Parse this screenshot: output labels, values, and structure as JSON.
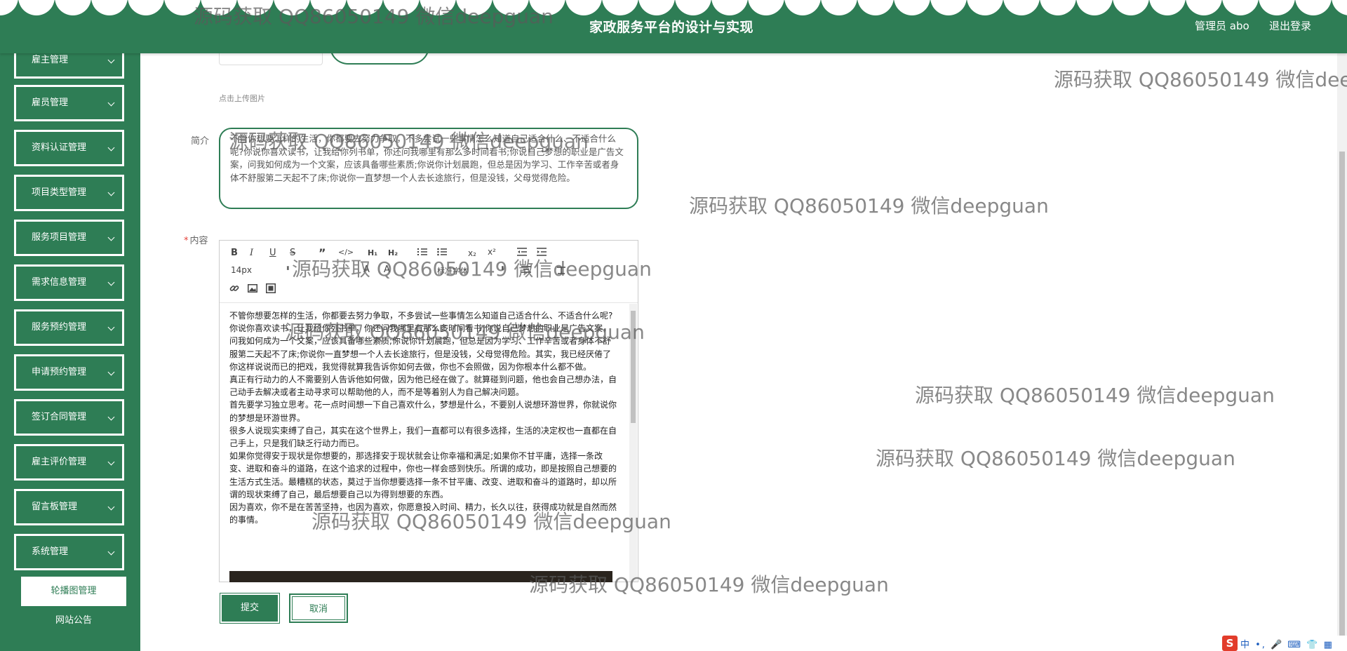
{
  "header": {
    "title": "家政服务平台的设计与实现",
    "admin": "管理员 abo",
    "logout": "退出登录"
  },
  "sidebar": {
    "items": [
      {
        "label": "雇主管理"
      },
      {
        "label": "雇员管理"
      },
      {
        "label": "资料认证管理"
      },
      {
        "label": "项目类型管理"
      },
      {
        "label": "服务项目管理"
      },
      {
        "label": "需求信息管理"
      },
      {
        "label": "服务预约管理"
      },
      {
        "label": "申请预约管理"
      },
      {
        "label": "签订合同管理"
      },
      {
        "label": "雇主评价管理"
      },
      {
        "label": "留言板管理"
      },
      {
        "label": "系统管理"
      }
    ],
    "sub_items": [
      {
        "label": "轮播图管理",
        "active": true
      },
      {
        "label": "网站公告",
        "active": false
      }
    ]
  },
  "form": {
    "upload_hint": "点击上传图片",
    "intro_label": "简介",
    "intro_text": "不管你想要怎样的生活，你都要去努力争取，不多尝试一些事情怎么知道自己适合什么、不适合什么呢?你说你喜欢读书，让我给你列书单，你还问我哪里有那么多时间看书;你说自己梦想的职业是广告文案，问我如何成为一个文案，应该具备哪些素质;你说你计划晨跑，但总是因为学习、工作辛苦或者身体不舒服第二天起不了床;你说你一直梦想一个人去长途旅行，但是没钱，父母觉得危险。",
    "content_label": "内容",
    "required_mark": "*",
    "font_size": "14px",
    "paragraph_select": "标准字体",
    "content_paragraphs": [
      "不管你想要怎样的生活，你都要去努力争取，不多尝试一些事情怎么知道自己适合什么、不适合什么呢?",
      "你说你喜欢读书，让我给你列书单，你还问我哪里有那么多时间看书;你说自己梦想的职业是广告文案，问我如何成为一个文案，应该具备哪些素质;你说你计划晨跑，但总是因为学习、工作辛苦或者身体不舒服第二天起不了床;你说你一直梦想一个人去长途旅行，但是没钱，父母觉得危险。其实，我已经厌倦了你这样说说而已的把戏，我觉得就算我告诉你如何去做，你也不会照做，因为你根本什么都不做。",
      "真正有行动力的人不需要别人告诉他如何做，因为他已经在做了。就算碰到问题，他也会自己想办法，自己动手去解决或者主动寻求可以帮助他的人，而不是等着别人为自己解决问题。",
      "首先要学习独立思考。花一点时间想一下自己喜欢什么，梦想是什么，不要别人说想环游世界，你就说你的梦想是环游世界。",
      "很多人说现实束缚了自己，其实在这个世界上，我们一直都可以有很多选择，生活的决定权也一直都在自己手上，只是我们缺乏行动力而已。",
      "如果你觉得安于现状是你想要的，那选择安于现状就会让你幸福和满足;如果你不甘平庸，选择一条改变、进取和奋斗的道路，在这个追求的过程中，你也一样会感到快乐。所谓的成功，即是按照自己想要的生活方式生活。最糟糕的状态，莫过于当你想要选择一条不甘平庸、改变、进取和奋斗的道路时，却以所谓的现状束缚了自己，最后想要自己以为得到想要的东西。",
      "因为喜欢，你不是在苦苦坚持，也因为喜欢，你愿意投入时间、精力，长久以往，获得成功就是自然而然的事情。"
    ],
    "submit": "提交",
    "cancel": "取消"
  },
  "ime": {
    "logo": "S",
    "text": "中 •, 🎤 ⌨ 👕 ▦"
  },
  "watermark": {
    "text": "源码获取 QQ86050149 微信deepguan"
  },
  "colors": {
    "primary": "#2e7d55",
    "required": "#e5423a"
  }
}
